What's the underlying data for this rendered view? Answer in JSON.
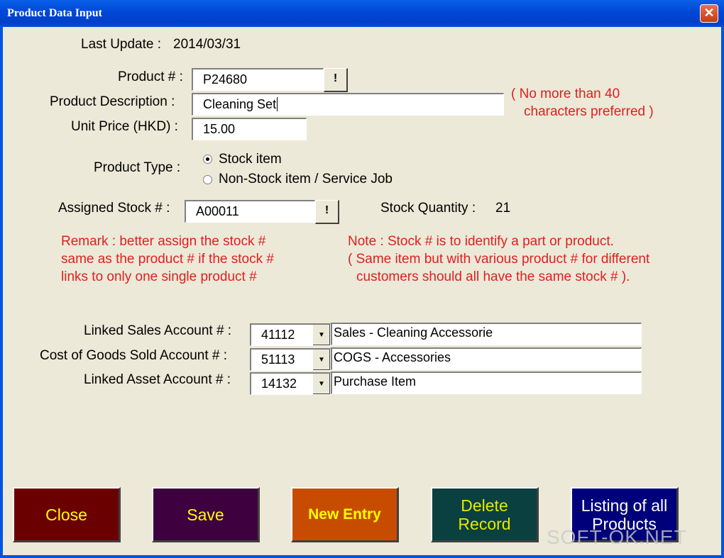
{
  "window": {
    "title": "Product Data Input",
    "close_glyph": "✕"
  },
  "last_update": {
    "label": "Last Update :",
    "value": "2014/03/31"
  },
  "product_no": {
    "label": "Product # :",
    "value": "P24680",
    "lookup_label": "!"
  },
  "product_description": {
    "label": "Product Description :",
    "value": "Cleaning Set"
  },
  "unit_price": {
    "label": "Unit Price (HKD) :",
    "value": "15.00"
  },
  "description_hint": {
    "line1": "( No more than 40",
    "line2": "characters preferred )"
  },
  "product_type": {
    "label": "Product Type :",
    "options": [
      "Stock item",
      "Non-Stock item / Service Job"
    ],
    "selected": "Stock item"
  },
  "assigned_stock": {
    "label": "Assigned Stock # :",
    "value": "A00011",
    "lookup_label": "!"
  },
  "stock_quantity": {
    "label": "Stock Quantity :",
    "value": "21"
  },
  "remark": {
    "line1": "Remark : better assign the stock #",
    "line2": "same as the product # if the stock #",
    "line3": "links to only one single product #"
  },
  "note": {
    "line1": "Note : Stock # is to identify a part or product.",
    "line2": "( Same item but with various product # for different",
    "line3": "customers should all have the same stock # )."
  },
  "accounts": [
    {
      "label": "Linked Sales Account # :",
      "code": "41112",
      "name": "Sales - Cleaning Accessorie"
    },
    {
      "label": "Cost of Goods Sold Account # :",
      "code": "51113",
      "name": "COGS - Accessories"
    },
    {
      "label": "Linked Asset Account # :",
      "code": "14132",
      "name": "Purchase Item"
    }
  ],
  "buttons": {
    "close": "Close",
    "save": "Save",
    "new_entry": "New Entry",
    "delete_line1": "Delete",
    "delete_line2": "Record",
    "listing_line1": "Listing of all",
    "listing_line2": "Products"
  },
  "colors": {
    "close_bg": "#6b0000",
    "save_bg": "#3f0040",
    "new_entry_bg": "#c84c00",
    "delete_bg": "#0b4040",
    "listing_bg": "#00007a",
    "hint_red": "#e02020"
  },
  "watermark": "SOFT-OK.NET"
}
